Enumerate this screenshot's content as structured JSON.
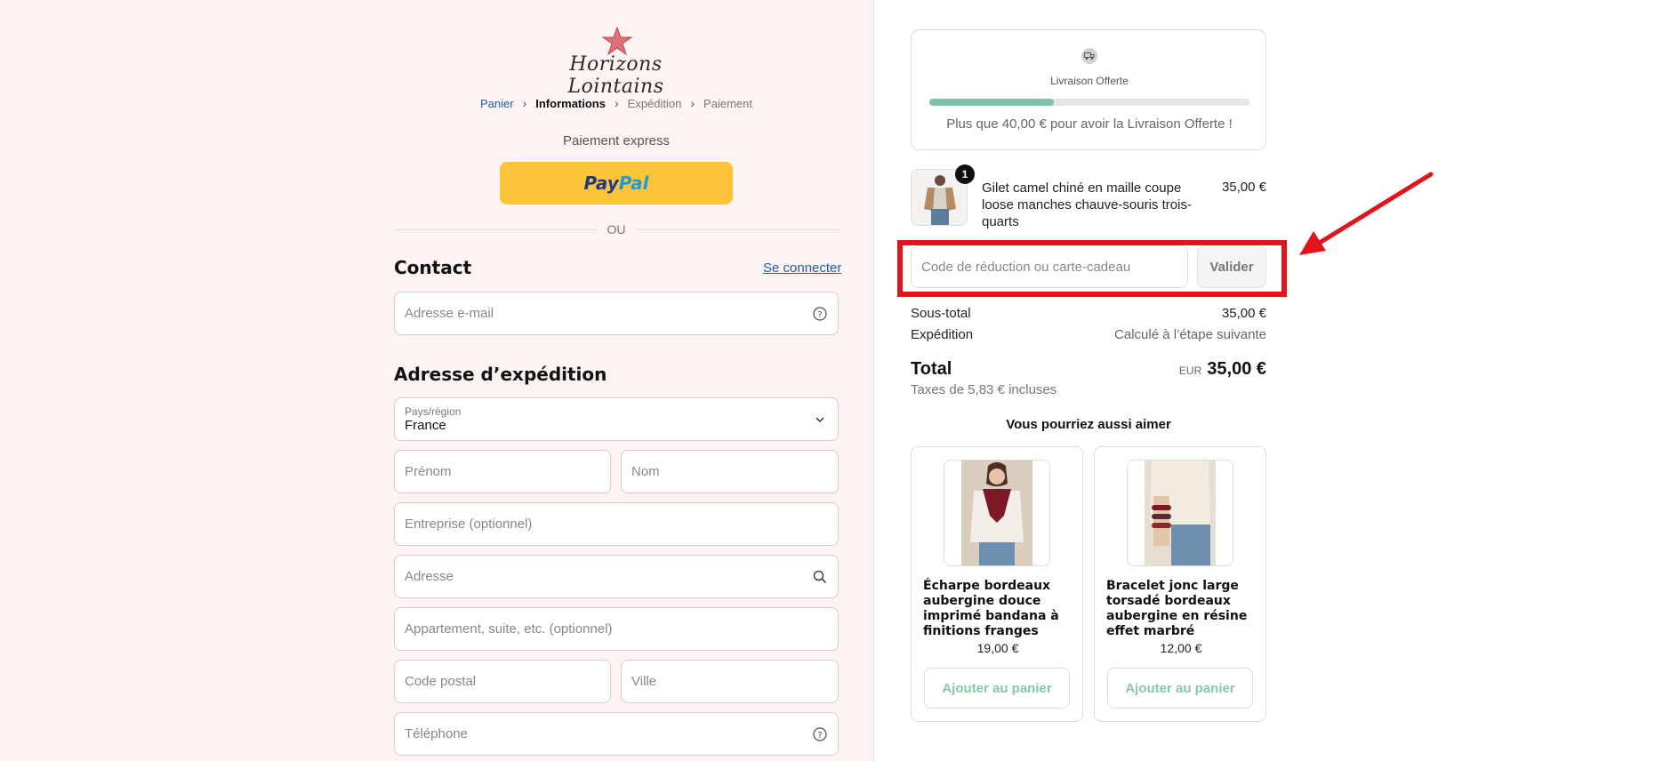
{
  "brand": {
    "name": "Horizons Lointains"
  },
  "breadcrumb": [
    {
      "label": "Panier"
    },
    {
      "label": "Informations"
    },
    {
      "label": "Expédition"
    },
    {
      "label": "Paiement"
    }
  ],
  "express": {
    "label": "Paiement express",
    "paypal_pay": "Pay",
    "paypal_pal": "Pal"
  },
  "divider": {
    "label": "OU"
  },
  "contact": {
    "title": "Contact",
    "login_link": "Se connecter",
    "email_placeholder": "Adresse e-mail"
  },
  "shipping_address": {
    "title": "Adresse d’expédition",
    "country_label": "Pays/région",
    "country_value": "France",
    "first_name_placeholder": "Prénom",
    "last_name_placeholder": "Nom",
    "company_placeholder": "Entreprise (optionnel)",
    "address_placeholder": "Adresse",
    "apartment_placeholder": "Appartement, suite, etc. (optionnel)",
    "postal_code_placeholder": "Code postal",
    "city_placeholder": "Ville",
    "phone_placeholder": "Téléphone"
  },
  "shipping_banner": {
    "title": "Livraison Offerte",
    "progress_fraction": 0.39,
    "message": "Plus que 40,00 € pour avoir la Livraison Offerte !"
  },
  "cart_item": {
    "quantity": "1",
    "name": "Gilet camel chiné en maille coupe loose manches chauve-souris trois-quarts",
    "price": "35,00 €"
  },
  "discount": {
    "placeholder": "Code de réduction ou carte-cadeau",
    "button_label": "Valider"
  },
  "summary": {
    "subtotal_label": "Sous-total",
    "subtotal_value": "35,00 €",
    "shipping_label": "Expédition",
    "shipping_value": "Calculé à l’étape suivante",
    "total_label": "Total",
    "currency": "EUR",
    "total_value": "35,00 €",
    "taxes": "Taxes de 5,83 € incluses"
  },
  "recommendations": {
    "title": "Vous pourriez aussi aimer",
    "items": [
      {
        "name": "Écharpe bordeaux aubergine douce imprimé bandana à finitions franges",
        "price": "19,00 €",
        "button_label": "Ajouter au panier"
      },
      {
        "name": "Bracelet jonc large torsadé bordeaux aubergine en résine effet marbré",
        "price": "12,00 €",
        "button_label": "Ajouter au panier"
      }
    ]
  },
  "colors": {
    "highlight": "#e0141a",
    "paypal_yellow": "#ffc43a",
    "progress_fill": "#7fc4a4",
    "link_blue": "#1b5fa8"
  },
  "icons": {
    "email_help": "help-circle-icon",
    "address_search": "search-icon",
    "phone_help": "help-circle-icon",
    "country_chevron": "chevron-down-icon",
    "shipping": "truck-icon"
  }
}
